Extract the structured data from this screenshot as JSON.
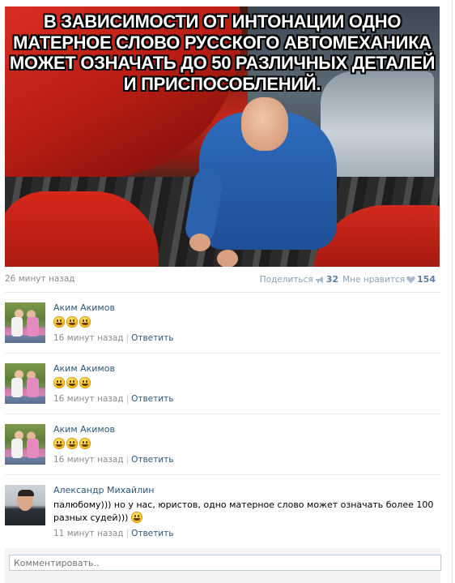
{
  "post": {
    "image_caption_lines": [
      "В зависимости от интонации одно",
      "матерное слово русского автомеханика",
      "может означать до 50 различных деталей",
      "и приспособлений."
    ],
    "time": "26 минут назад",
    "share_label": "Поделиться",
    "share_count": "32",
    "like_label": "Мне нравится",
    "like_count": "154"
  },
  "comments": [
    {
      "author": "Аким Акимов",
      "emoji_count": 3,
      "time": "16 минут назад",
      "reply": "Ответить"
    },
    {
      "author": "Аким Акимов",
      "emoji_count": 3,
      "time": "16 минут назад",
      "reply": "Ответить"
    },
    {
      "author": "Аким Акимов",
      "emoji_count": 3,
      "time": "16 минут назад",
      "reply": "Ответить"
    },
    {
      "author": "Александр Михайлин",
      "text": "палюбому))) но у нас, юристов, одно матерное слово может означать более 100 разных судей)))",
      "time": "11 минут назад",
      "reply": "Ответить"
    }
  ],
  "comment_input": {
    "placeholder": "Комментировать.."
  },
  "colors": {
    "link": "#2b587a",
    "muted": "#8c8c8c",
    "counter": "#5b7fa6"
  }
}
